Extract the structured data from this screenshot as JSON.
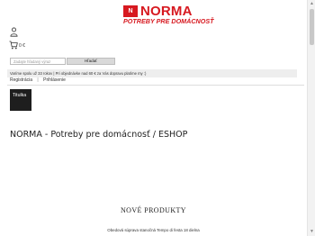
{
  "header": {
    "logo_mark": "N",
    "brand": "NORMA",
    "tagline": "POTREBY PRE DOMÁCNOSŤ"
  },
  "cart": {
    "total": "0 €"
  },
  "search": {
    "placeholder": "Zadajte hľadaný výraz",
    "button_label": "Hľadať"
  },
  "info_bar": {
    "text": "Varíme spolu už 33 rokov | Pri objednávke nad 60 € za Vás dopravu platíme my :)"
  },
  "account_links": {
    "register": "Registrácia",
    "separator": "|",
    "login": "Prihlásenie"
  },
  "nav": {
    "home_tab": "Titulka"
  },
  "main": {
    "page_heading": "NORMA - Potreby pre domácnosť / ESHOP",
    "new_products_title": "NOVÉ PRODUKTY",
    "products": [
      {
        "name": "Obedová súprava stanočná Tempo di festa 18 dielna"
      }
    ]
  },
  "colors": {
    "brand_red": "#d71920",
    "info_bar_bg": "#eeeeee",
    "tab_bg": "#1e1e1e"
  }
}
